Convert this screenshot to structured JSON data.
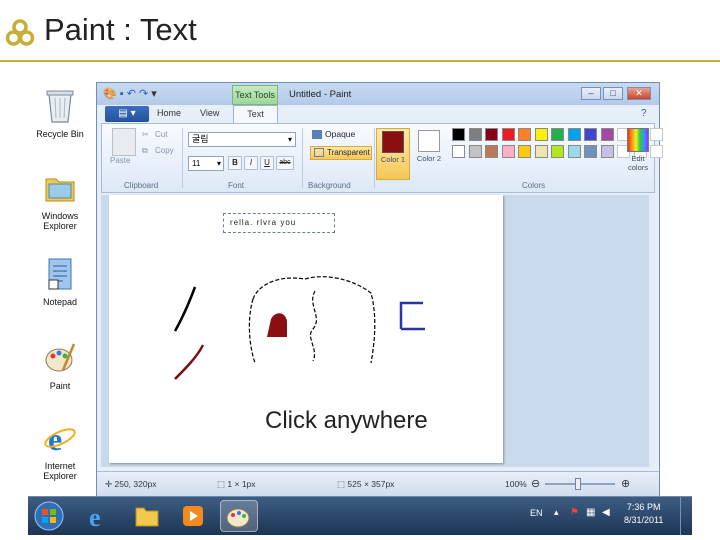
{
  "slide": {
    "title": "Paint : Text"
  },
  "desktop_icons": [
    {
      "label": "Recycle Bin",
      "icon": "recycle-bin-icon"
    },
    {
      "label": "Windows Explorer",
      "icon": "folder-icon"
    },
    {
      "label": "Notepad",
      "icon": "notepad-icon"
    },
    {
      "label": "Paint",
      "icon": "paint-palette-icon"
    },
    {
      "label": "Internet Explorer",
      "icon": "internet-explorer-icon"
    }
  ],
  "window": {
    "title": "Untitled - Paint",
    "contextual_tab_group": "Text Tools",
    "controls": {
      "minimize": "–",
      "maximize": "□",
      "close": "✕"
    }
  },
  "ribbon": {
    "tabs": [
      "Home",
      "View",
      "Text"
    ],
    "active_tab": "Text",
    "clipboard": {
      "paste": "Paste",
      "cut": "Cut",
      "copy": "Copy",
      "label": "Clipboard"
    },
    "font": {
      "family": "굴림",
      "size": "11",
      "bold": "B",
      "italic": "I",
      "underline": "U",
      "strike": "abc",
      "label": "Font"
    },
    "background": {
      "opaque": "Opaque",
      "transparent": "Transparent",
      "label": "Background"
    },
    "colors": {
      "color1_label": "Color 1",
      "color1_value": "#8b0e12",
      "color2_label": "Color 2",
      "color2_value": "#ffffff",
      "edit_colors": "Edit colors",
      "label": "Colors",
      "palette_row1": [
        "#000000",
        "#7f7f7f",
        "#880015",
        "#ed1c24",
        "#ff7f27",
        "#fff200",
        "#22b14c",
        "#00a2e8",
        "#3f48cc",
        "#a349a4"
      ],
      "palette_row2": [
        "#ffffff",
        "#c3c3c3",
        "#b97a57",
        "#ffaec9",
        "#ffc90e",
        "#efe4b0",
        "#b5e61d",
        "#99d9ea",
        "#7092be",
        "#c8bfe7"
      ]
    }
  },
  "canvas": {
    "textbox_text": "rella. rlvra you",
    "annotation": "Click anywhere"
  },
  "statusbar": {
    "cursor_pos": "250, 320px",
    "selection_size": "1 × 1px",
    "canvas_size": "525 × 357px",
    "zoom": "100%"
  },
  "taskbar": {
    "language": "EN",
    "time": "7:36 PM",
    "date": "8/31/2011"
  }
}
